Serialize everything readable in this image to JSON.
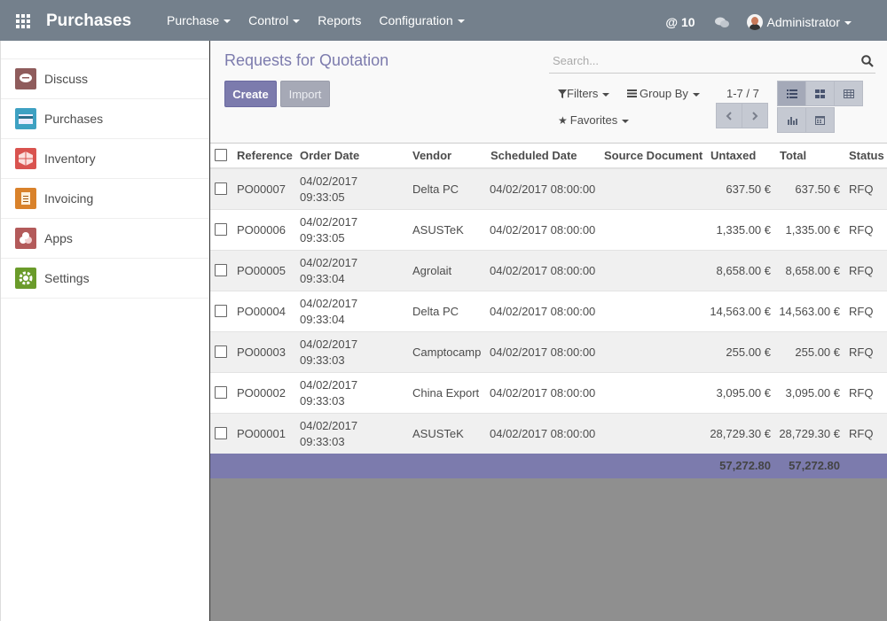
{
  "topbar": {
    "brand": "Purchases",
    "menu": [
      {
        "label": "Purchase",
        "dropdown": true
      },
      {
        "label": "Control",
        "dropdown": true
      },
      {
        "label": "Reports",
        "dropdown": false
      },
      {
        "label": "Configuration",
        "dropdown": true
      }
    ],
    "mentions": "@ 10",
    "user": "Administrator",
    "color": "#74808c"
  },
  "sidebar": {
    "items": [
      {
        "label": "Discuss",
        "icon": "discuss-icon",
        "color": "#8f5c5c"
      },
      {
        "label": "Purchases",
        "icon": "purchases-icon",
        "color": "#3ea1c2"
      },
      {
        "label": "Inventory",
        "icon": "inventory-icon",
        "color": "#d9534f"
      },
      {
        "label": "Invoicing",
        "icon": "invoicing-icon",
        "color": "#d9822b"
      },
      {
        "label": "Apps",
        "icon": "apps-icon",
        "color": "#b35a5a"
      },
      {
        "label": "Settings",
        "icon": "settings-icon",
        "color": "#6a9b2a"
      }
    ]
  },
  "control": {
    "title": "Requests for Quotation",
    "search_placeholder": "Search...",
    "create_label": "Create",
    "import_label": "Import",
    "filters_label": "Filters",
    "groupby_label": "Group By",
    "favorites_label": "Favorites",
    "pager": "1-7 / 7"
  },
  "table": {
    "headers": {
      "reference": "Reference",
      "order_date": "Order Date",
      "vendor": "Vendor",
      "scheduled_date": "Scheduled Date",
      "source_document": "Source Document",
      "untaxed": "Untaxed",
      "total": "Total",
      "status": "Status"
    },
    "rows": [
      {
        "reference": "PO00007",
        "order_date": "04/02/2017",
        "order_time": "09:33:05",
        "vendor": "Delta PC",
        "scheduled_date": "04/02/2017 08:00:00",
        "source_document": "",
        "untaxed": "637.50 €",
        "total": "637.50 €",
        "status": "RFQ"
      },
      {
        "reference": "PO00006",
        "order_date": "04/02/2017",
        "order_time": "09:33:05",
        "vendor": "ASUSTeK",
        "scheduled_date": "04/02/2017 08:00:00",
        "source_document": "",
        "untaxed": "1,335.00 €",
        "total": "1,335.00 €",
        "status": "RFQ"
      },
      {
        "reference": "PO00005",
        "order_date": "04/02/2017",
        "order_time": "09:33:04",
        "vendor": "Agrolait",
        "scheduled_date": "04/02/2017 08:00:00",
        "source_document": "",
        "untaxed": "8,658.00 €",
        "total": "8,658.00 €",
        "status": "RFQ"
      },
      {
        "reference": "PO00004",
        "order_date": "04/02/2017",
        "order_time": "09:33:04",
        "vendor": "Delta PC",
        "scheduled_date": "04/02/2017 08:00:00",
        "source_document": "",
        "untaxed": "14,563.00 €",
        "total": "14,563.00 €",
        "status": "RFQ"
      },
      {
        "reference": "PO00003",
        "order_date": "04/02/2017",
        "order_time": "09:33:03",
        "vendor": "Camptocamp",
        "scheduled_date": "04/02/2017 08:00:00",
        "source_document": "",
        "untaxed": "255.00 €",
        "total": "255.00 €",
        "status": "RFQ"
      },
      {
        "reference": "PO00002",
        "order_date": "04/02/2017",
        "order_time": "09:33:03",
        "vendor": "China Export",
        "scheduled_date": "04/02/2017 08:00:00",
        "source_document": "",
        "untaxed": "3,095.00 €",
        "total": "3,095.00 €",
        "status": "RFQ"
      },
      {
        "reference": "PO00001",
        "order_date": "04/02/2017",
        "order_time": "09:33:03",
        "vendor": "ASUSTeK",
        "scheduled_date": "04/02/2017 08:00:00",
        "source_document": "",
        "untaxed": "28,729.30 €",
        "total": "28,729.30 €",
        "status": "RFQ"
      }
    ],
    "totals": {
      "untaxed": "57,272.80",
      "total": "57,272.80"
    },
    "accent": "#7c7bad"
  }
}
